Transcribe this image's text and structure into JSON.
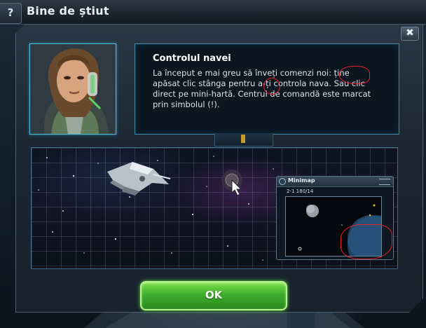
{
  "window": {
    "title": "Bine de știut",
    "help_label": "?",
    "close_label": "✖"
  },
  "info": {
    "title": "Controlul navei",
    "text": "La început e mai greu să înveți comenzi noi: ține apăsat clic stânga pentru a-ți controla nava. Sau clic direct pe mini-hartă. Centrul de comandă este marcat prin simbolul (!)."
  },
  "minimap": {
    "title": "Minimap",
    "coords": "2-1 180/14"
  },
  "buttons": {
    "ok_label": "OK"
  },
  "colors": {
    "accent_cyan": "#3e8bae",
    "ok_green": "#3fae2c",
    "annotation_red": "#e8202a"
  },
  "icons": {
    "help": "question-mark-icon",
    "close": "close-icon",
    "cursor": "mouse-cursor-icon",
    "minimap": "minimap-icon"
  }
}
